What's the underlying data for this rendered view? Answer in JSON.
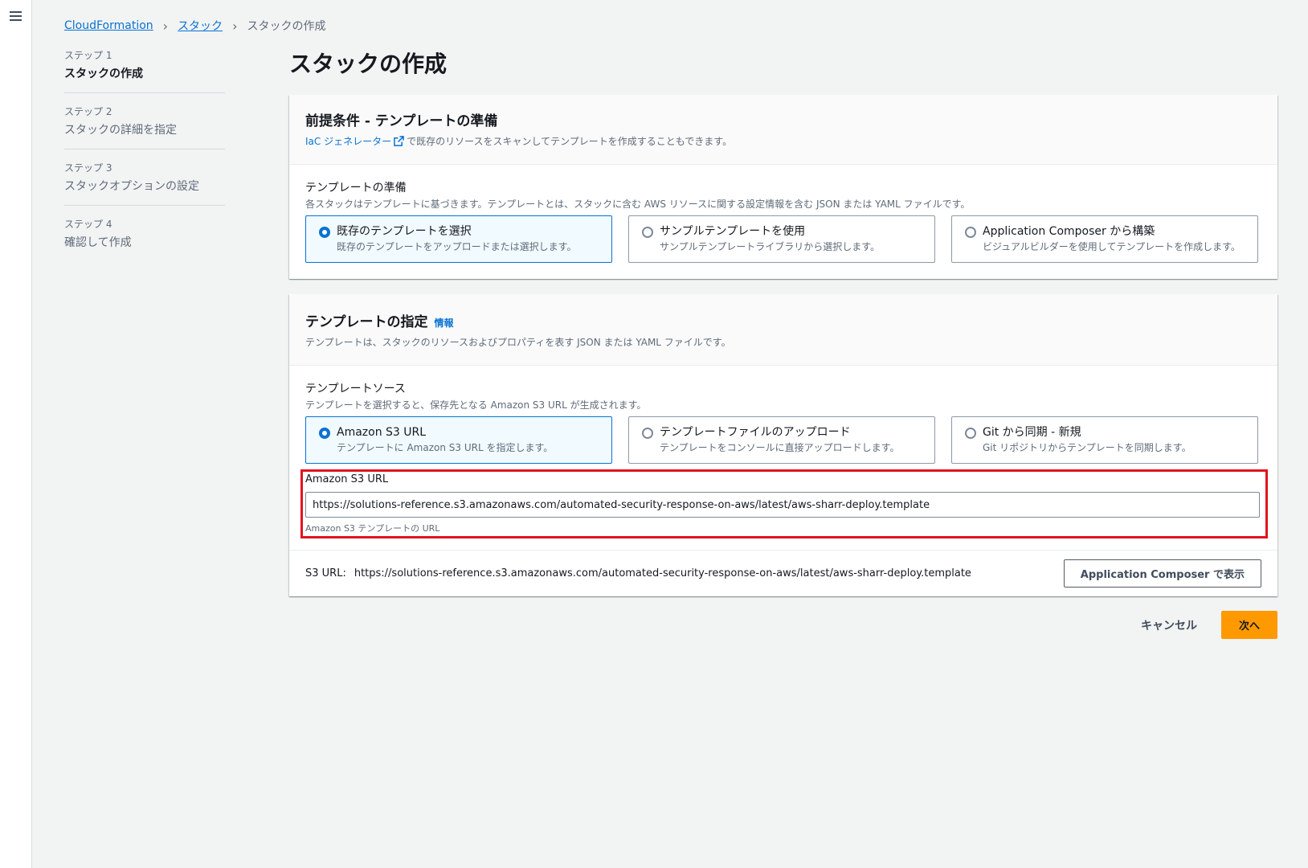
{
  "breadcrumb": {
    "items": [
      "CloudFormation",
      "スタック"
    ],
    "current": "スタックの作成"
  },
  "steps": [
    {
      "num": "ステップ 1",
      "title": "スタックの作成"
    },
    {
      "num": "ステップ 2",
      "title": "スタックの詳細を指定"
    },
    {
      "num": "ステップ 3",
      "title": "スタックオプションの設定"
    },
    {
      "num": "ステップ 4",
      "title": "確認して作成"
    }
  ],
  "page_title": "スタックの作成",
  "prereq": {
    "title": "前提条件 - テンプレートの準備",
    "iac_link": "IaC ジェネレーター",
    "iac_desc": "で既存のリソースをスキャンしてテンプレートを作成することもできます。",
    "field_label": "テンプレートの準備",
    "field_desc": "各スタックはテンプレートに基づきます。テンプレートとは、スタックに含む AWS リソースに関する設定情報を含む JSON または YAML ファイルです。",
    "options": [
      {
        "title": "既存のテンプレートを選択",
        "desc": "既存のテンプレートをアップロードまたは選択します。"
      },
      {
        "title": "サンプルテンプレートを使用",
        "desc": "サンプルテンプレートライブラリから選択します。"
      },
      {
        "title": "Application Composer から構築",
        "desc": "ビジュアルビルダーを使用してテンプレートを作成します。"
      }
    ]
  },
  "spec": {
    "title": "テンプレートの指定",
    "info": "情報",
    "desc": "テンプレートは、スタックのリソースおよびプロパティを表す JSON または YAML ファイルです。",
    "field_label": "テンプレートソース",
    "field_desc": "テンプレートを選択すると、保存先となる Amazon S3 URL が生成されます。",
    "options": [
      {
        "title": "Amazon S3 URL",
        "desc": "テンプレートに Amazon S3 URL を指定します。"
      },
      {
        "title": "テンプレートファイルのアップロード",
        "desc": "テンプレートをコンソールに直接アップロードします。"
      },
      {
        "title": "Git から同期 - 新規",
        "desc": "Git リポジトリからテンプレートを同期します。"
      }
    ],
    "s3_label": "Amazon S3 URL",
    "s3_value": "https://solutions-reference.s3.amazonaws.com/automated-security-response-on-aws/latest/aws-sharr-deploy.template",
    "s3_hint": "Amazon S3 テンプレートの URL",
    "footer_label": "S3 URL:",
    "footer_value": "https://solutions-reference.s3.amazonaws.com/automated-security-response-on-aws/latest/aws-sharr-deploy.template",
    "view_button": "Application Composer で表示"
  },
  "actions": {
    "cancel": "キャンセル",
    "next": "次へ"
  },
  "colors": {
    "accent": "#0972d3",
    "primary_button": "#ff9900",
    "highlight_box": "#e0141e"
  }
}
